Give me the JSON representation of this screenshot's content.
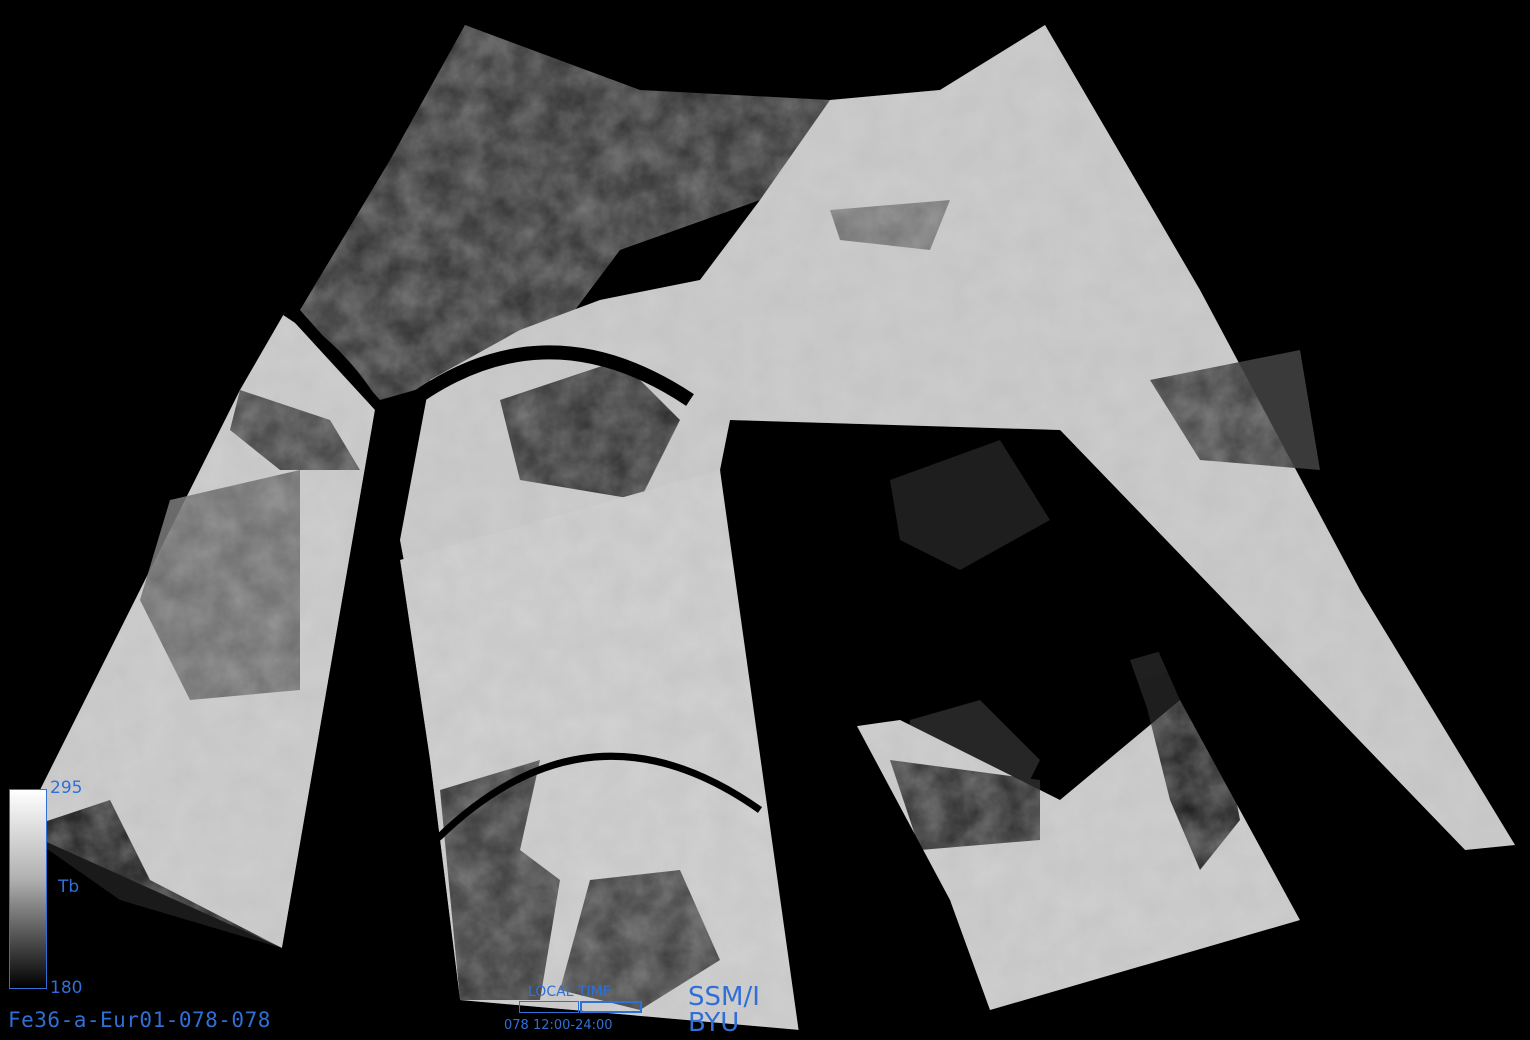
{
  "image_id": "Fe36-a-Eur01-078-078",
  "colorbar": {
    "max": "295",
    "min": "180",
    "unit": "Tb"
  },
  "local_time": {
    "label": "LOCAL TIME",
    "range": "078 12:00-24:00"
  },
  "sensor": "SSM/I",
  "organization": "BYU",
  "colors": {
    "label": "#2f6fd6",
    "background": "#000000"
  }
}
